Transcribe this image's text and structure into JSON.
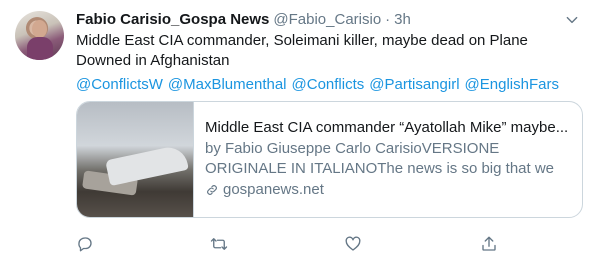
{
  "tweet": {
    "display_name": "Fabio Carisio_Gospa News",
    "handle": "@Fabio_Carisio",
    "separator": "·",
    "time": "3h",
    "text": "Middle East CIA commander, Soleimani killer, maybe dead on Plane Downed in Afghanistan",
    "mentions": [
      "@ConflictsW",
      "@MaxBlumenthal",
      "@Conflicts",
      "@Partisangirl",
      "@EnglishFars"
    ]
  },
  "card": {
    "title": "Middle East CIA commander “Ayatollah Mike” maybe...",
    "description": "by Fabio Giuseppe Carlo CarisioVERSIONE ORIGINALE IN ITALIANOThe news is so big that we have to write...",
    "domain": "gospanews.net"
  },
  "colors": {
    "link": "#1b95e0",
    "secondary_text": "#657786",
    "primary_text": "#14171a",
    "border": "#ccd6dd"
  },
  "icons": {
    "more": "chevron-down-icon",
    "reply": "reply-icon",
    "retweet": "retweet-icon",
    "like": "heart-icon",
    "share": "share-icon",
    "link": "link-icon"
  }
}
